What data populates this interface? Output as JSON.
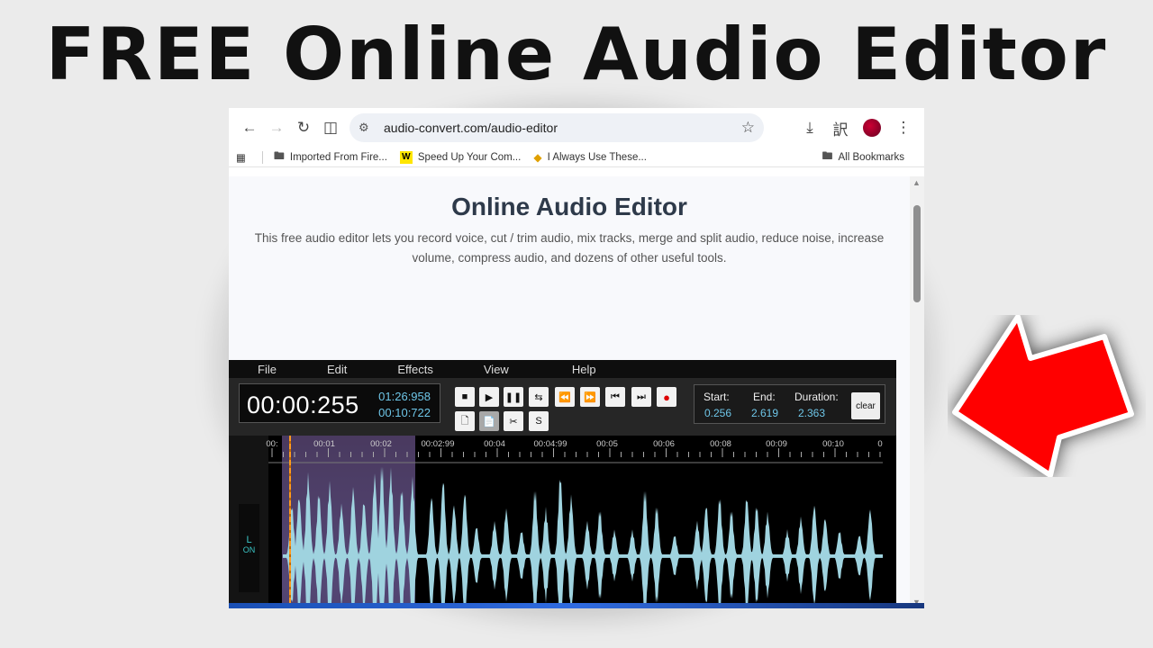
{
  "hero": {
    "title": "FREE Online Audio Editor"
  },
  "browser": {
    "url": "audio-convert.com/audio-editor",
    "bookmarks": [
      {
        "label": "Imported From Fire...",
        "icon": "folder-icon"
      },
      {
        "label": "Speed Up Your Com...",
        "icon": "w-logo-icon"
      },
      {
        "label": "I Always Use These...",
        "icon": "diamond-icon"
      }
    ],
    "all_bookmarks": "All Bookmarks"
  },
  "page": {
    "title": "Online Audio Editor",
    "description": "This free audio editor lets you record voice, cut / trim audio, mix tracks, merge and split audio, reduce noise, increase volume, compress audio, and dozens of other useful tools."
  },
  "editor": {
    "menu": [
      "File",
      "Edit",
      "Effects",
      "View",
      "Help"
    ],
    "time_main": "00:00:255",
    "time_total": "01:26:958",
    "time_selected": "00:10:722",
    "selection": {
      "start_label": "Start:",
      "start": "0.256",
      "end_label": "End:",
      "end": "2.619",
      "duration_label": "Duration:",
      "duration": "2.363",
      "clear_label": "clear"
    },
    "buttons_row2_s": "S",
    "channel": {
      "label": "L",
      "state": "ON"
    },
    "ticks": [
      "00:",
      "00:01",
      "00:02",
      "00:02:99",
      "00:04",
      "00:04:99",
      "00:05",
      "00:06",
      "00:08",
      "00:09",
      "00:10",
      "0"
    ]
  },
  "colors": {
    "accent_time": "#6ec6e8",
    "waveform": "#9fd3df",
    "selection": "#6c5a96",
    "cursor": "#ff9a1e",
    "arrow": "#ff0000"
  }
}
